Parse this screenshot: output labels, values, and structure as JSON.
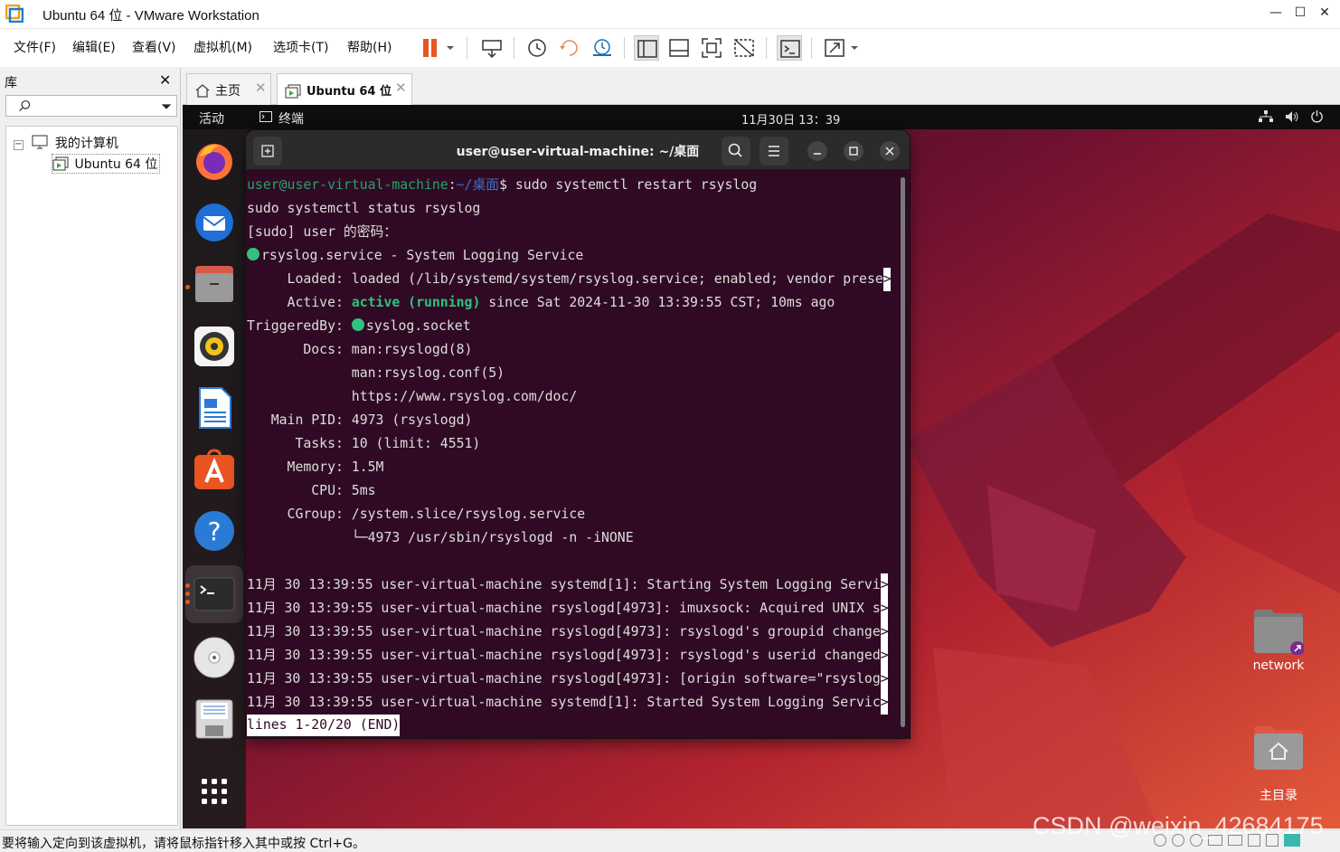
{
  "window": {
    "title": "Ubuntu 64 位 - VMware Workstation"
  },
  "menu": [
    "文件(F)",
    "编辑(E)",
    "查看(V)",
    "虚拟机(M)",
    "选项卡(T)",
    "帮助(H)"
  ],
  "library": {
    "title": "库",
    "tree_root": "我的计算机",
    "tree_vm": "Ubuntu 64 位"
  },
  "tabs": [
    {
      "label": "主页"
    },
    {
      "label": "Ubuntu 64 位"
    }
  ],
  "gnome": {
    "activities": "活动",
    "app_name": "终端",
    "clock": "11月30日  13：39"
  },
  "terminal": {
    "title": "user@user-virtual-machine: ~/桌面",
    "prompt_user": "user@user-virtual-machine",
    "prompt_path": "~/桌面",
    "command": "sudo systemctl restart rsyslog",
    "lines": [
      "sudo systemctl status rsyslog",
      "[sudo] user 的密码：",
      "rsyslog.service - System Logging Service",
      "     Loaded: loaded (/lib/systemd/system/rsyslog.service; enabled; vendor prese",
      "since Sat 2024-11-30 13:39:55 CST; 10ms ago",
      "TriggeredBy: ",
      "syslog.socket",
      "       Docs: man:rsyslogd(8)",
      "             man:rsyslog.conf(5)",
      "             https://www.rsyslog.com/doc/",
      "   Main PID: 4973 (rsyslogd)",
      "      Tasks: 10 (limit: 4551)",
      "     Memory: 1.5M",
      "        CPU: 5ms",
      "     CGroup: /system.slice/rsyslog.service",
      "             └─4973 /usr/sbin/rsyslogd -n -iNONE",
      "11月 30 13:39:55 user-virtual-machine systemd[1]: Starting System Logging Servi",
      "11月 30 13:39:55 user-virtual-machine rsyslogd[4973]: imuxsock: Acquired UNIX s",
      "11月 30 13:39:55 user-virtual-machine rsyslogd[4973]: rsyslogd's groupid change",
      "11月 30 13:39:55 user-virtual-machine rsyslogd[4973]: rsyslogd's userid changed",
      "11月 30 13:39:55 user-virtual-machine rsyslogd[4973]: [origin software=\"rsyslog",
      "11月 30 13:39:55 user-virtual-machine systemd[1]: Started System Logging Servic",
      "lines 1-20/20 (END)"
    ],
    "active_label": "     Active: ",
    "active_state": "active (running)"
  },
  "desktop": {
    "icon1": "network",
    "icon2": "主目录"
  },
  "status": "要将输入定向到该虚拟机，请将鼠标指针移入其中或按 Ctrl+G。",
  "watermark": "CSDN @weixin_42684175",
  "colors": {
    "terminal_bg": "#300a24",
    "ubuntu_orange": "#e95420",
    "active_green": "#2ec27e"
  }
}
